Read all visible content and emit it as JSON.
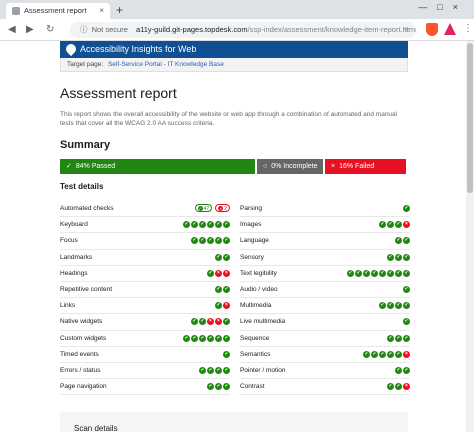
{
  "browser": {
    "tab_title": "Assessment report",
    "tab_close": "×",
    "new_tab": "+",
    "window_controls": "—□×",
    "back_icon": "◀",
    "forward_icon": "▶",
    "reload_icon": "↻",
    "security_icon": "ⓘ",
    "security_text": "Not secure",
    "url_host": "a11y-guild.git-pages.topdesk.com",
    "url_path": "/ssp-index/assessment/knowledge-item-report.html",
    "star_icon": "☆",
    "menu_icon": "⋮"
  },
  "header": {
    "title": "Accessibility Insights for Web",
    "target_label": "Target page:",
    "target_link": "Self-Service Portal - IT Knowledge Base"
  },
  "report": {
    "title": "Assessment report",
    "intro": "This report shows the overall accessibility of the website or web app through a combination of automated and manual tests that cover all the WCAG 2.0 AA success criteria.",
    "summary_heading": "Summary",
    "passed": "84% Passed",
    "incomplete": "0% Incomplete",
    "failed": "16% Failed",
    "details_heading": "Test details",
    "scan_heading": "Scan details"
  },
  "glyphs": {
    "pass": "✓",
    "fail": "×",
    "incomplete": "○"
  },
  "colors": {
    "pass": "#228613",
    "fail": "#e81123",
    "incomplete": "#666666",
    "header": "#0f4f92"
  },
  "automated_checks": {
    "pass_count": "47",
    "fail_count": "2"
  },
  "tests_left": [
    {
      "name": "Automated checks",
      "results": []
    },
    {
      "name": "Keyboard",
      "results": [
        "p",
        "p",
        "p",
        "p",
        "p",
        "p"
      ]
    },
    {
      "name": "Focus",
      "results": [
        "p",
        "p",
        "p",
        "p",
        "p"
      ]
    },
    {
      "name": "Landmarks",
      "results": [
        "p",
        "p"
      ]
    },
    {
      "name": "Headings",
      "results": [
        "p",
        "f",
        "f"
      ]
    },
    {
      "name": "Repetitive content",
      "results": [
        "p",
        "p"
      ]
    },
    {
      "name": "Links",
      "results": [
        "p",
        "f"
      ]
    },
    {
      "name": "Native widgets",
      "results": [
        "p",
        "p",
        "f",
        "f",
        "p"
      ]
    },
    {
      "name": "Custom widgets",
      "results": [
        "p",
        "p",
        "p",
        "p",
        "p",
        "p"
      ]
    },
    {
      "name": "Timed events",
      "results": [
        "p"
      ]
    },
    {
      "name": "Errors / status",
      "results": [
        "p",
        "p",
        "p",
        "p"
      ]
    },
    {
      "name": "Page navigation",
      "results": [
        "p",
        "p",
        "p"
      ]
    }
  ],
  "tests_right": [
    {
      "name": "Parsing",
      "results": [
        "p"
      ]
    },
    {
      "name": "Images",
      "results": [
        "p",
        "p",
        "p",
        "f"
      ]
    },
    {
      "name": "Language",
      "results": [
        "p",
        "p"
      ]
    },
    {
      "name": "Sensory",
      "results": [
        "p",
        "p",
        "p"
      ]
    },
    {
      "name": "Text legibility",
      "results": [
        "p",
        "p",
        "p",
        "p",
        "p",
        "p",
        "p",
        "p"
      ]
    },
    {
      "name": "Audio / video",
      "results": [
        "p"
      ]
    },
    {
      "name": "Multimedia",
      "results": [
        "p",
        "p",
        "p",
        "p"
      ]
    },
    {
      "name": "Live multimedia",
      "results": [
        "p"
      ]
    },
    {
      "name": "Sequence",
      "results": [
        "p",
        "p",
        "p"
      ]
    },
    {
      "name": "Semantics",
      "results": [
        "p",
        "p",
        "p",
        "p",
        "p",
        "f"
      ]
    },
    {
      "name": "Pointer / motion",
      "results": [
        "p",
        "p"
      ]
    },
    {
      "name": "Contrast",
      "results": [
        "p",
        "p",
        "f"
      ]
    }
  ]
}
